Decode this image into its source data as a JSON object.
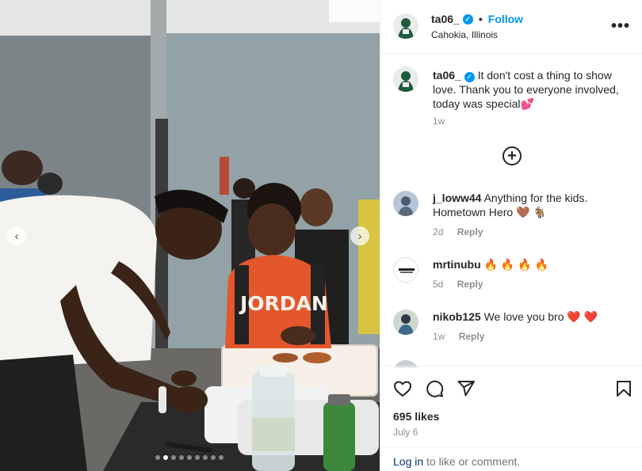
{
  "post": {
    "username": "ta06_",
    "follow_label": "Follow",
    "location": "Cahokia, Illinois",
    "more_label": "•••",
    "caption": {
      "text": "It don't cost a thing to show love. Thank you to everyone involved, today was special",
      "emoji": "💕",
      "time": "1w"
    },
    "load_more_symbol": "+",
    "comments": [
      {
        "username": "j_loww44",
        "text": "Anything for the kids. Hometown Hero",
        "emoji": "🤎 🐐",
        "time": "2d",
        "reply_label": "Reply"
      },
      {
        "username": "mrtinubu",
        "text": "",
        "emoji": "🔥 🔥 🔥 🔥",
        "time": "5d",
        "reply_label": "Reply"
      },
      {
        "username": "nikob125",
        "text": "We love you bro",
        "emoji": "❤️ ❤️",
        "time": "1w",
        "reply_label": "Reply"
      }
    ],
    "likes": "695 likes",
    "date": "July 6",
    "login_link": "Log in",
    "login_rest": " to like or comment."
  },
  "media": {
    "carousel_total": 9,
    "carousel_active_index": 1,
    "prev_symbol": "‹",
    "next_symbol": "›",
    "shirt_text": "JORDAN"
  },
  "colors": {
    "accent": "#0095f6",
    "text": "#262626",
    "muted": "#8e8e8e",
    "link": "#00376b",
    "divider": "#efefef"
  },
  "icons": {
    "like": "heart-outline-icon",
    "comment": "speech-bubble-icon",
    "share": "paper-plane-icon",
    "save": "bookmark-icon",
    "more": "ellipsis-icon",
    "load_more": "plus-circle-icon",
    "verified": "verified-badge-icon"
  }
}
